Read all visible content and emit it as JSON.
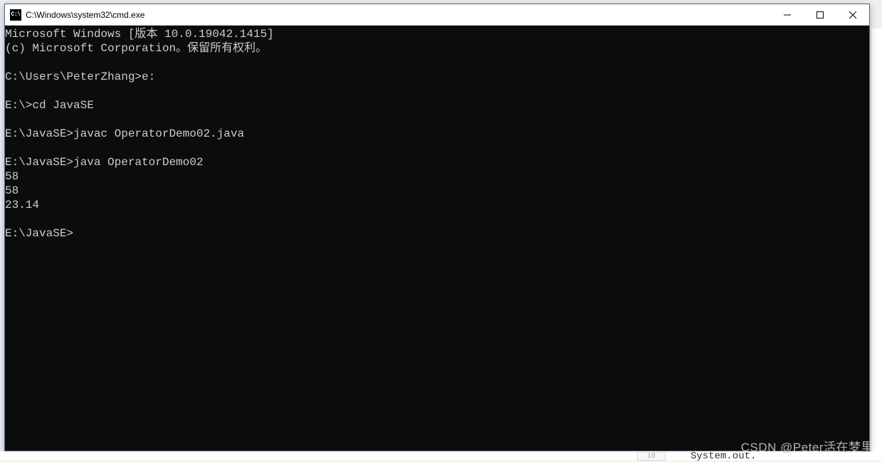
{
  "window": {
    "title": "C:\\Windows\\system32\\cmd.exe",
    "icon_label": "C:\\"
  },
  "terminal": {
    "lines": [
      "Microsoft Windows [版本 10.0.19042.1415]",
      "(c) Microsoft Corporation。保留所有权利。",
      "",
      "C:\\Users\\PeterZhang>e:",
      "",
      "E:\\>cd JavaSE",
      "",
      "E:\\JavaSE>javac OperatorDemo02.java",
      "",
      "E:\\JavaSE>java OperatorDemo02",
      "58",
      "58",
      "23.14",
      "",
      "E:\\JavaSE>"
    ]
  },
  "watermark": "CSDN @Peter活在梦里",
  "bg": {
    "gutter": "16",
    "code_fragment": "System.out."
  }
}
